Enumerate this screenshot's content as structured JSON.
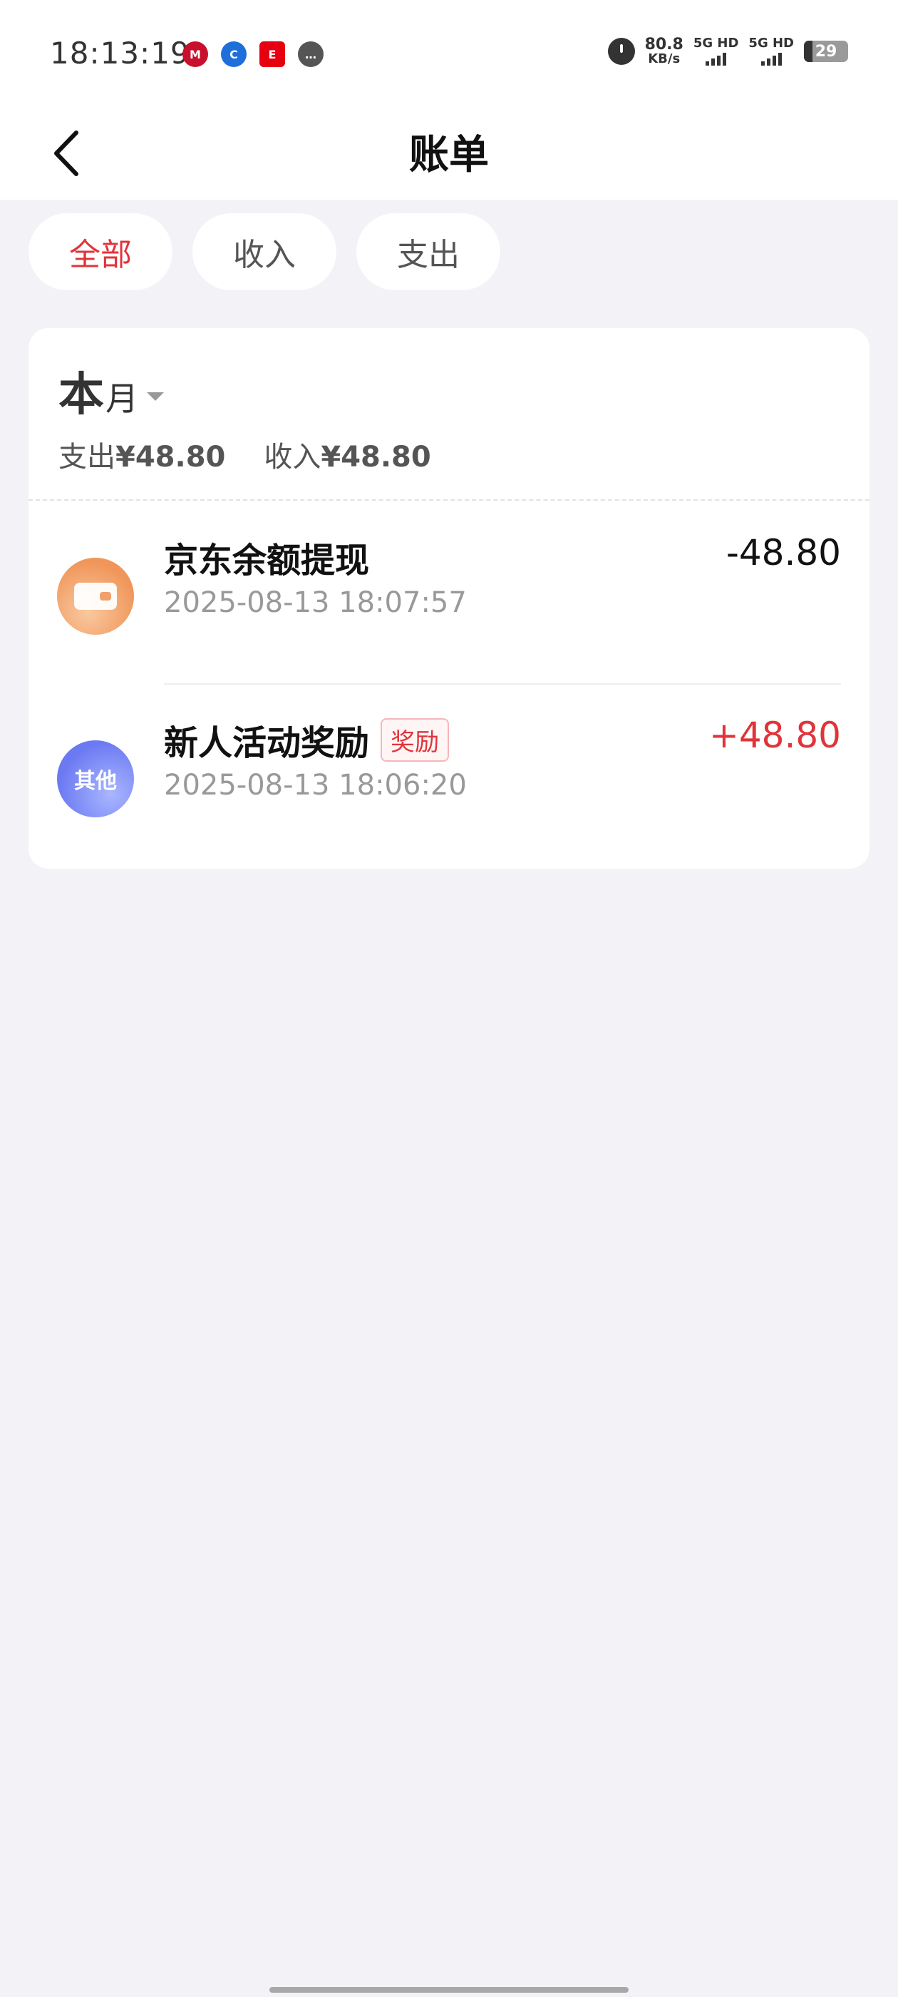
{
  "status_bar": {
    "time": "18:13:19",
    "net_speed_value": "80.8",
    "net_speed_unit": "KB/s",
    "sim1": "5G HD",
    "sim2": "5G HD",
    "battery": "29",
    "app_icons": [
      "china-merchants-bank-icon",
      "ccb-icon",
      "epay-icon",
      "message-icon"
    ]
  },
  "nav": {
    "title": "账单"
  },
  "filters": {
    "tabs": [
      "全部",
      "收入",
      "支出"
    ],
    "active": 0
  },
  "summary": {
    "month_big": "本",
    "month_small": "月",
    "expense_label": "支出",
    "expense_amount": "¥48.80",
    "income_label": "收入",
    "income_amount": "¥48.80"
  },
  "transactions": [
    {
      "title": "京东余额提现",
      "time": "2025-08-13 18:07:57",
      "amount": "-48.80",
      "icon": "wallet-icon"
    },
    {
      "title": "新人活动奖励",
      "tag": "奖励",
      "time": "2025-08-13 18:06:20",
      "amount": "+48.80",
      "icon_label": "其他"
    }
  ],
  "colors": {
    "accent": "#e0343a",
    "background": "#f2f2f7",
    "card": "#ffffff"
  }
}
